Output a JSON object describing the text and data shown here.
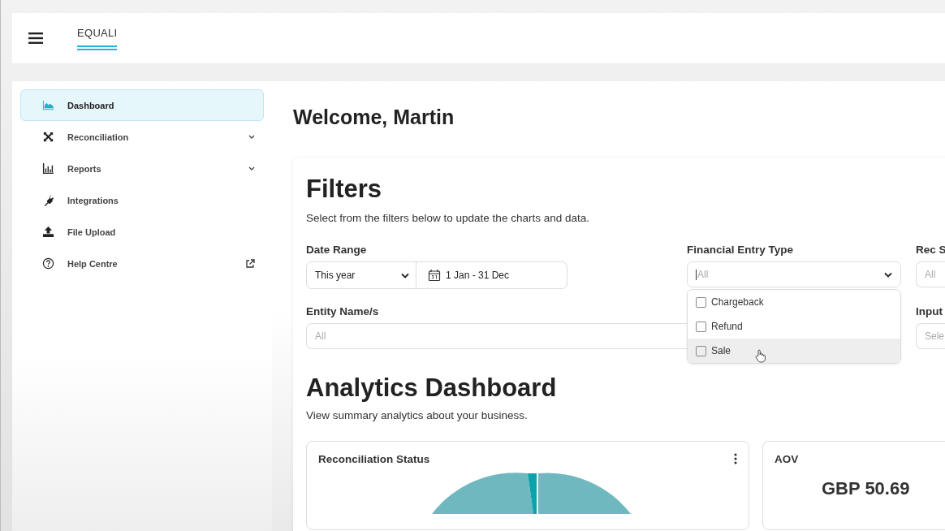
{
  "header": {
    "logo": "EQUALI"
  },
  "sidebar": {
    "items": [
      {
        "label": "Dashboard",
        "selected": true,
        "expandable": false,
        "external": false
      },
      {
        "label": "Reconciliation",
        "selected": false,
        "expandable": true,
        "external": false
      },
      {
        "label": "Reports",
        "selected": false,
        "expandable": true,
        "external": false
      },
      {
        "label": "Integrations",
        "selected": false,
        "expandable": false,
        "external": false
      },
      {
        "label": "File Upload",
        "selected": false,
        "expandable": false,
        "external": false
      },
      {
        "label": "Help Centre",
        "selected": false,
        "expandable": false,
        "external": true
      }
    ]
  },
  "greeting": "Welcome, Martin",
  "filters": {
    "title": "Filters",
    "subtitle": "Select from the filters below to update the charts and data.",
    "date_range": {
      "label": "Date Range",
      "preset": "This year",
      "range": "1 Jan - 31 Dec"
    },
    "financial_entry_type": {
      "label": "Financial Entry Type",
      "placeholder": "All",
      "expanded": true,
      "options": [
        {
          "label": "Chargeback",
          "checked": false,
          "hovered": false
        },
        {
          "label": "Refund",
          "checked": false,
          "hovered": false
        },
        {
          "label": "Sale",
          "checked": false,
          "hovered": true
        }
      ]
    },
    "rec_status": {
      "label": "Rec S",
      "placeholder": "All"
    },
    "entity_names": {
      "label": "Entity Name/s",
      "placeholder": "All"
    },
    "input": {
      "label": "Input",
      "placeholder": "Sele"
    }
  },
  "analytics": {
    "title": "Analytics Dashboard",
    "subtitle": "View summary analytics about your business.",
    "cards": [
      {
        "title": "Reconciliation Status",
        "kind": "pie"
      },
      {
        "title": "AOV",
        "kind": "value",
        "value": "GBP 50.69"
      }
    ]
  }
}
